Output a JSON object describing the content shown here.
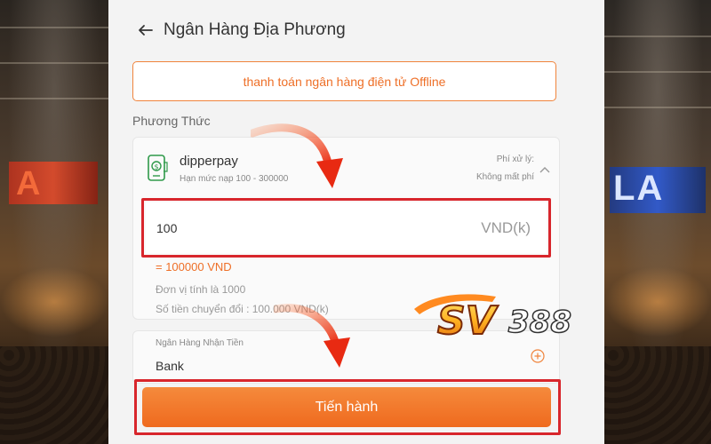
{
  "header": {
    "title": "Ngân Hàng Địa Phương",
    "back_icon": "arrow-left-icon"
  },
  "offline_notice": "thanh toán ngân hàng điện tử Offline",
  "method": {
    "section_label": "Phương Thức",
    "name": "dipperpay",
    "limit": "Hạn mức nạp 100 - 300000",
    "fee_label": "Phí xử lý:",
    "fee_value": "Không mất phí"
  },
  "amount": {
    "value": "100",
    "unit": "VND(k)",
    "converted": "= 100000 VND",
    "unit_note": "Đơn vị tính là 1000",
    "convert_note": "Số tiền chuyển đổi : 100.000 VND(k)"
  },
  "bank": {
    "label": "Ngân Hàng Nhận Tiền",
    "value": "Bank"
  },
  "proceed_label": "Tiến hành",
  "colors": {
    "accent": "#ef6a1e",
    "highlight": "#d8262c",
    "panel_bg": "#f3f3f3"
  }
}
